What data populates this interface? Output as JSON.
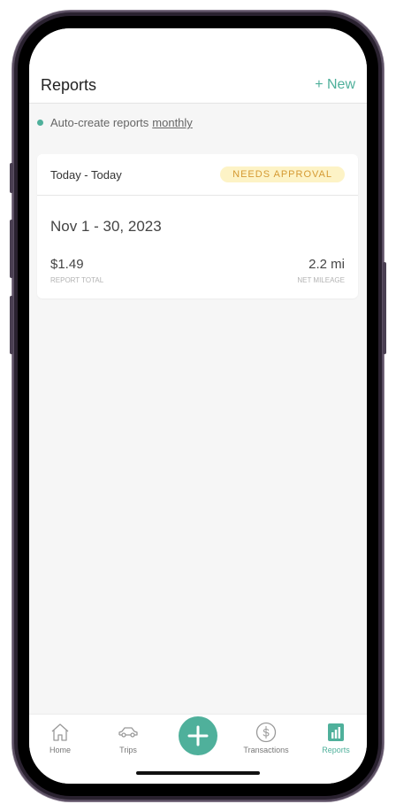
{
  "header": {
    "title": "Reports",
    "new_label": "+ New"
  },
  "auto_create": {
    "text": "Auto-create reports",
    "frequency": "monthly"
  },
  "report_card": {
    "range_label": "Today - Today",
    "status_badge": "NEEDS APPROVAL",
    "period": "Nov 1 - 30, 2023",
    "total_value": "$1.49",
    "total_label": "REPORT TOTAL",
    "mileage_value": "2.2 mi",
    "mileage_label": "NET MILEAGE"
  },
  "tabs": [
    {
      "label": "Home",
      "icon": "home-icon"
    },
    {
      "label": "Trips",
      "icon": "car-icon"
    },
    {
      "label": "",
      "icon": "plus-icon"
    },
    {
      "label": "Transactions",
      "icon": "dollar-circle-icon"
    },
    {
      "label": "Reports",
      "icon": "report-chart-icon",
      "active": true
    }
  ],
  "colors": {
    "accent": "#4fb09b",
    "badge_bg": "#fdf3c6",
    "badge_text": "#d59a33"
  }
}
